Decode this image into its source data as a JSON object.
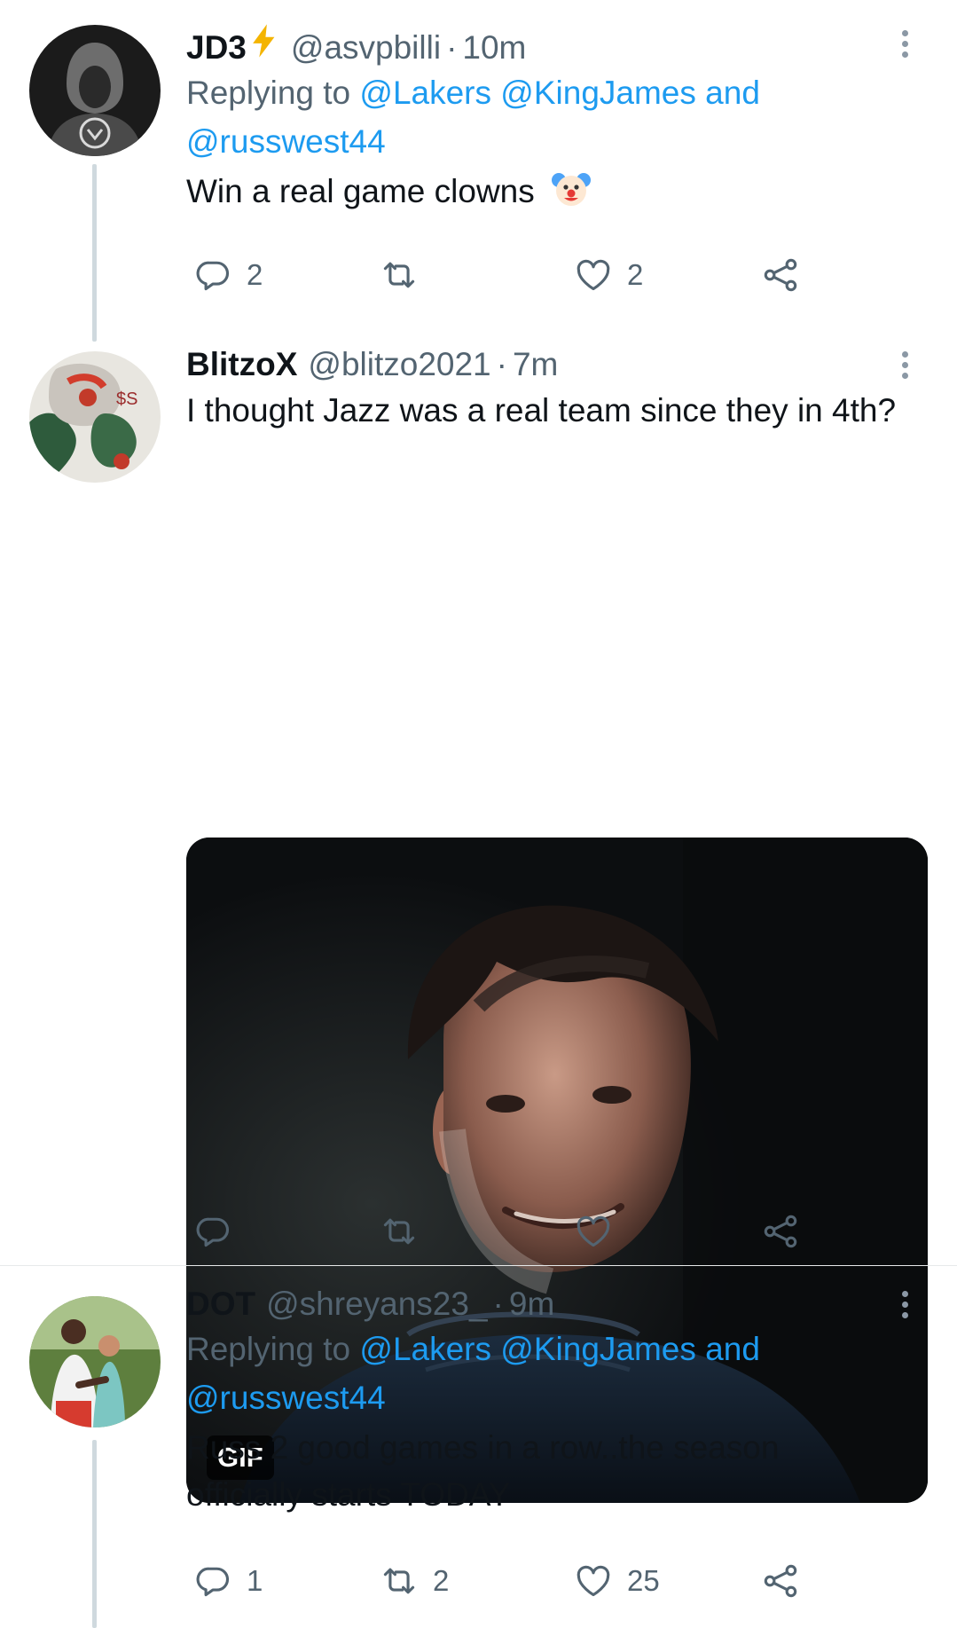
{
  "tweets": [
    {
      "name": "JD3",
      "handle": "@asvpbilli",
      "sep": "·",
      "time": "10m",
      "replying_prefix": "Replying to",
      "mentions": [
        "@Lakers",
        "@KingJames",
        "@russwest44"
      ],
      "and_word": "and",
      "text": "Win a real game clowns",
      "emoji": "clown-face",
      "counts": {
        "reply": "2",
        "retweet": "",
        "like": "2"
      }
    },
    {
      "name": "BlitzoX",
      "handle": "@blitzo2021",
      "sep": "·",
      "time": "7m",
      "text": "I thought Jazz was a real team since they in 4th?",
      "media_badge": "GIF",
      "counts": {
        "reply": "",
        "retweet": "",
        "like": ""
      }
    },
    {
      "name": "DOT",
      "handle": "@shreyans23_",
      "sep": "·",
      "time": "9m",
      "replying_prefix": "Replying to",
      "mentions": [
        "@Lakers",
        "@KingJames",
        "@russwest44"
      ],
      "and_word": "and",
      "text": "Russ 2 good games in a row..the season officially starts TODAY",
      "counts": {
        "reply": "1",
        "retweet": "2",
        "like": "25"
      }
    }
  ],
  "colors": {
    "accent": "#1d9bf0",
    "muted": "#536471",
    "text": "#0f1419",
    "thread_line": "#cfd9de",
    "divider": "#e7e9ea",
    "bolt": "#f4b400"
  },
  "icons": {
    "reply": "reply-bubble-icon",
    "retweet": "retweet-icon",
    "like": "heart-icon",
    "share": "share-icon",
    "more": "more-dots-icon"
  }
}
